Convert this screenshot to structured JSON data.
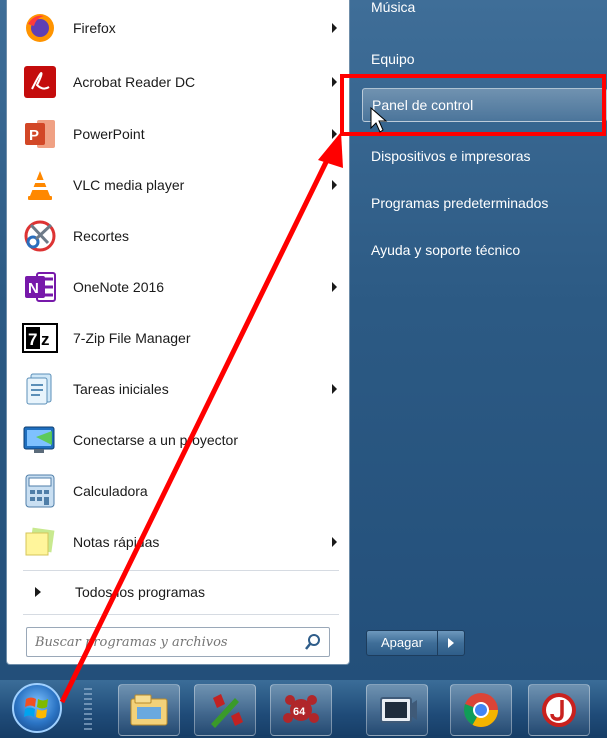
{
  "programs": [
    {
      "label": "Firefox",
      "icon": "firefox-icon",
      "submenu": true
    },
    {
      "label": "Acrobat Reader DC",
      "icon": "acrobat-icon",
      "submenu": true
    },
    {
      "label": "PowerPoint",
      "icon": "powerpoint-icon",
      "submenu": true
    },
    {
      "label": "VLC media player",
      "icon": "vlc-icon",
      "submenu": true
    },
    {
      "label": "Recortes",
      "icon": "scissors-icon",
      "submenu": false
    },
    {
      "label": "OneNote 2016",
      "icon": "onenote-icon",
      "submenu": true
    },
    {
      "label": "7-Zip File Manager",
      "icon": "7zip-icon",
      "submenu": false
    },
    {
      "label": "Tareas iniciales",
      "icon": "getting-started-icon",
      "submenu": true
    },
    {
      "label": "Conectarse a un proyector",
      "icon": "projector-icon",
      "submenu": false
    },
    {
      "label": "Calculadora",
      "icon": "calculator-icon",
      "submenu": false
    },
    {
      "label": "Notas rápidas",
      "icon": "sticky-notes-icon",
      "submenu": true
    }
  ],
  "all_programs_label": "Todos los programas",
  "search": {
    "placeholder": "Buscar programas y archivos",
    "icon": "search-icon"
  },
  "right_pane": {
    "items": [
      {
        "label": "Música",
        "highlighted": false
      },
      {
        "label": "Equipo",
        "highlighted": false
      },
      {
        "label": "Panel de control",
        "highlighted": true
      },
      {
        "label": "Dispositivos e impresoras",
        "highlighted": false
      },
      {
        "label": "Programas predeterminados",
        "highlighted": false
      },
      {
        "label": "Ayuda y soporte técnico",
        "highlighted": false
      }
    ],
    "shutdown_label": "Apagar"
  },
  "taskbar": {
    "pinned": [
      "file-explorer-icon",
      "app-icon",
      "game-icon",
      "video-icon",
      "chrome-icon",
      "java-icon"
    ],
    "badge_text": "64"
  },
  "annotation": {
    "color": "#ff0000"
  }
}
